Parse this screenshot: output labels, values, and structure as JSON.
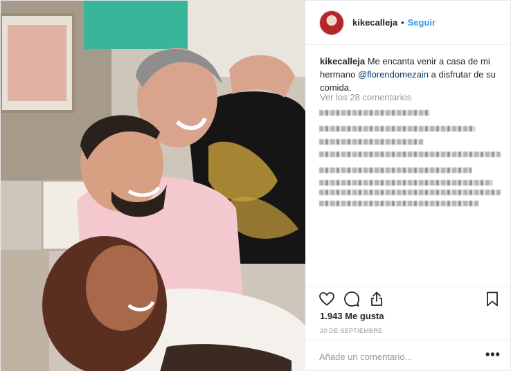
{
  "header": {
    "username": "kikecalleja",
    "separator": "•",
    "follow_label": "Seguir",
    "avatar_icon": "profile-avatar"
  },
  "caption": {
    "username": "kikecalleja",
    "text_before": "Me encanta venir a casa de mi hermano",
    "mention": "@florendomezain",
    "text_after": "a disfrutar de su comida."
  },
  "view_comments": "Ver los 28 comentarios",
  "actions": {
    "like_icon": "heart-icon",
    "comment_icon": "comment-icon",
    "share_icon": "share-icon",
    "save_icon": "bookmark-icon"
  },
  "likes": "1.943 Me gusta",
  "date": "20 DE SEPTIEMBRE",
  "comment_box": {
    "placeholder": "Añade un comentario...",
    "more_label": "•••"
  },
  "colors": {
    "link_blue": "#3897f0",
    "mention_blue": "#003569",
    "muted": "#999999",
    "text": "#262626"
  }
}
